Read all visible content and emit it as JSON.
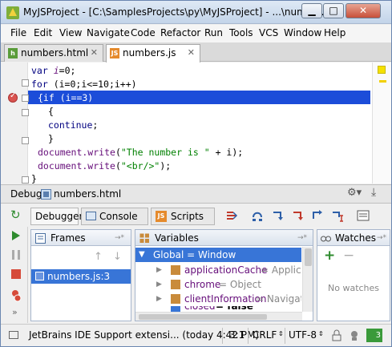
{
  "window": {
    "title": "MyJSProject - [C:\\SamplesProjects\\py\\MyJSProject] - ...\\number...",
    "minimize_label": "▁",
    "maximize_label": "□",
    "close_label": "✕"
  },
  "menu": [
    "File",
    "Edit",
    "View",
    "Navigate",
    "Code",
    "Refactor",
    "Run",
    "Tools",
    "VCS",
    "Window",
    "Help"
  ],
  "editor_tabs": [
    {
      "label": "numbers.html",
      "icon": "html-file-icon",
      "close": "✕",
      "active": false
    },
    {
      "label": "numbers.js",
      "icon": "js-file-icon",
      "close": "✕",
      "active": true
    }
  ],
  "code": {
    "line1": {
      "kw": "var ",
      "var": "i",
      "rest": "=0;"
    },
    "line2": {
      "kw": "for ",
      "rest": "(i=0;i<=10;i++)"
    },
    "line3": {
      "text": "{if (i==3)"
    },
    "line4": {
      "text": "{"
    },
    "line5": {
      "kw": "continue",
      "rest": ";"
    },
    "line6": {
      "text": "}"
    },
    "line7": {
      "fn": "document.write",
      "p1": "(",
      "str": "\"The number is \"",
      "rest": " + i);"
    },
    "line8": {
      "fn": "document.write",
      "p1": "(",
      "str": "\"<br/>\"",
      "rest": ");"
    },
    "line9": {
      "text": "}"
    }
  },
  "debug": {
    "label": "Debug",
    "config": "numbers.html",
    "tabs": [
      "Debugger",
      "Console",
      "Scripts"
    ],
    "tab_pin": "→*"
  },
  "frames": {
    "title": "Frames",
    "pin": "→*",
    "items": [
      "numbers.js:3"
    ]
  },
  "variables": {
    "title": "Variables",
    "pin": "→*",
    "root": "Global = Window",
    "items": [
      {
        "name": "applicationCache",
        "value": "= Application"
      },
      {
        "name": "chrome",
        "value": "= Object"
      },
      {
        "name": "clientInformation",
        "value": "= Navigator"
      },
      {
        "name": "closed",
        "value": "= false"
      }
    ]
  },
  "watches": {
    "title": "Watches",
    "pin": "→*",
    "add": "+",
    "remove": "−",
    "empty": "No watches"
  },
  "status": {
    "message": "JetBrains IDE Support extensi... (today 4:42 PM)",
    "position": "3:1",
    "line_sep": "CRLF",
    "encoding": "UTF-8",
    "badge": "3"
  },
  "colors": {
    "selection": "#1c4dd9",
    "breakpoint": "#d9534f",
    "string": "#008000",
    "keyword": "#000080"
  }
}
